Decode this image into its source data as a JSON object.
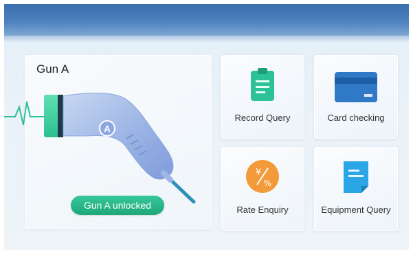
{
  "gun_panel": {
    "title": "Gun A",
    "connector_letter": "A",
    "status": "Gun A unlocked"
  },
  "tiles": [
    {
      "label": "Record Query",
      "icon": "clipboard-icon"
    },
    {
      "label": "Card checking",
      "icon": "card-icon"
    },
    {
      "label": "Rate Enquiry",
      "icon": "rate-icon",
      "icon_text": "¥/%"
    },
    {
      "label": "Equipment Query",
      "icon": "document-icon"
    }
  ],
  "colors": {
    "header_blue": "#3b6fae",
    "status_green": "#1fa87a",
    "clipboard_green": "#2cc196",
    "card_blue": "#2f79c7",
    "rate_orange": "#f39a3a",
    "document_blue": "#2aa6e6"
  }
}
